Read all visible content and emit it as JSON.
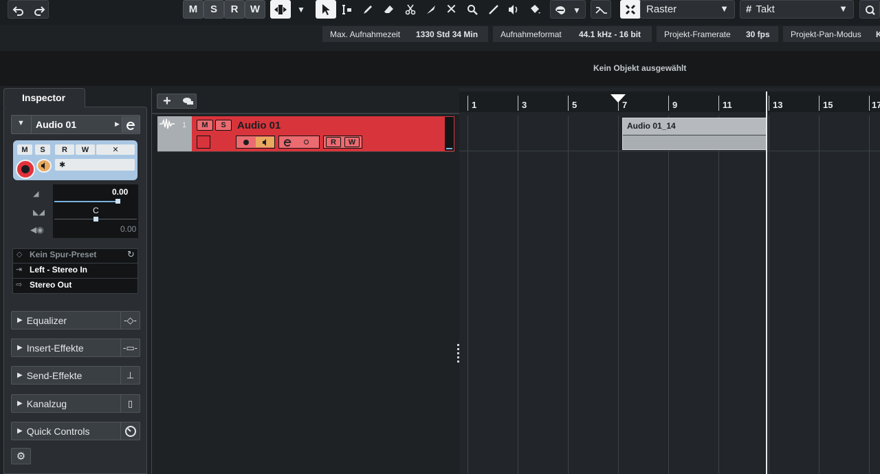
{
  "toolbar": {
    "undo_icon": "undo-icon",
    "redo_icon": "redo-icon",
    "mode_buttons": [
      "M",
      "S",
      "R",
      "W"
    ],
    "grid_type": "Raster",
    "grid_value": "Takt"
  },
  "info_line": [
    {
      "label": "Max. Aufnahmezeit",
      "value": "1330 Std 34 Min"
    },
    {
      "label": "Aufnahmeformat",
      "value": "44.1 kHz - 16 bit"
    },
    {
      "label": "Projekt-Framerate",
      "value": "30 fps"
    },
    {
      "label": "Projekt-Pan-Modus",
      "value": "K"
    }
  ],
  "status": {
    "selection": "Kein Objekt ausgewählt"
  },
  "inspector": {
    "tab": "Inspector",
    "track_name": "Audio 01",
    "buttons": {
      "m": "M",
      "s": "S",
      "r": "R",
      "w": "W"
    },
    "volume_value": "0.00",
    "pan_value": "C",
    "delay_value": "0.00",
    "routing": {
      "preset": "Kein Spur-Preset",
      "input": "Left - Stereo In",
      "output": "Stereo Out"
    },
    "sections": [
      "Equalizer",
      "Insert-Effekte",
      "Send-Effekte",
      "Kanalzug",
      "Quick Controls"
    ]
  },
  "track": {
    "number": "1",
    "name": "Audio 01",
    "m": "M",
    "s": "S",
    "r": "R",
    "w": "W"
  },
  "ruler": {
    "bars": [
      "1",
      "3",
      "5",
      "7",
      "9",
      "11",
      "13",
      "15",
      "17"
    ]
  },
  "event": {
    "name": "Audio 01_14"
  },
  "colors": {
    "track_red": "#d8343b",
    "accent_blue": "#7ab3df"
  }
}
